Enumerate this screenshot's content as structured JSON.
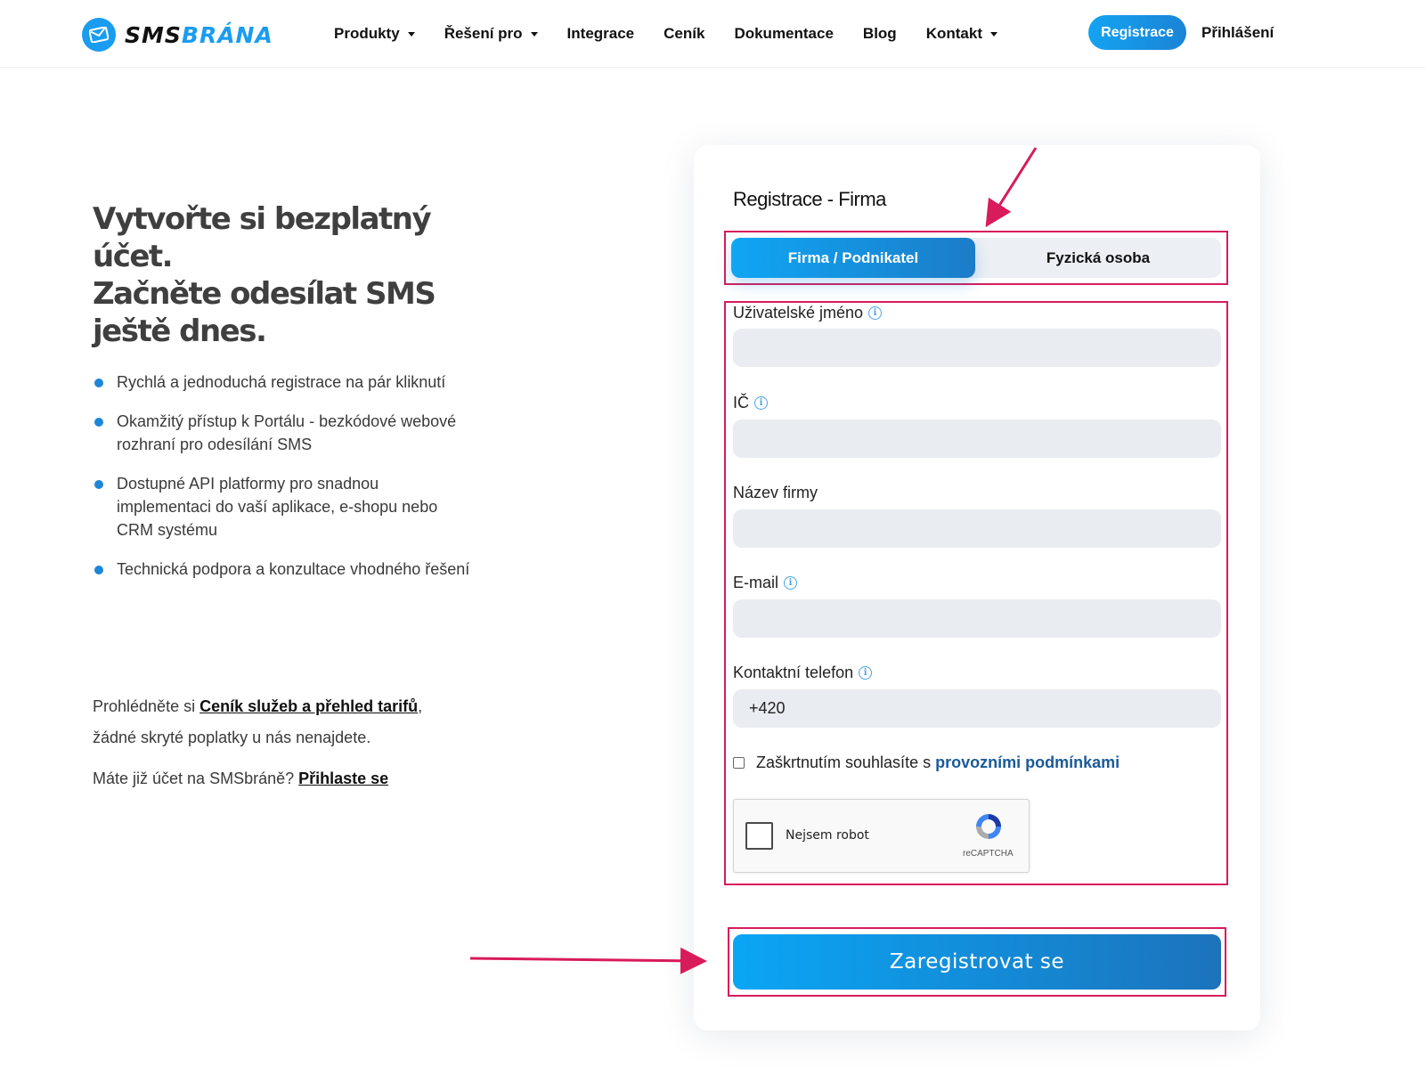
{
  "header": {
    "logo": {
      "part1": "SMS",
      "part2": "BRÁNA"
    },
    "nav": [
      {
        "label": "Produkty",
        "dropdown": true
      },
      {
        "label": "Řešení pro",
        "dropdown": true
      },
      {
        "label": "Integrace",
        "dropdown": false
      },
      {
        "label": "Ceník",
        "dropdown": false
      },
      {
        "label": "Dokumentace",
        "dropdown": false
      },
      {
        "label": "Blog",
        "dropdown": false
      },
      {
        "label": "Kontakt",
        "dropdown": true
      }
    ],
    "register_label": "Registrace",
    "login_label": "Přihlášení"
  },
  "hero": {
    "title_line1": "Vytvořte si bezplatný účet.",
    "title_line2": "Začněte odesílat SMS",
    "title_line3": "ještě dnes.",
    "bullets": [
      "Rychlá a jednoduchá registrace na pár kliknutí",
      "Okamžitý přístup k Portálu - bezkódové webové rozhraní pro odesílání SMS",
      "Dostupné API platformy pro snadnou implementaci do vaší aplikace, e-shopu nebo CRM systému",
      "Technická podpora a konzultace vhodného řešení"
    ],
    "pricing_prefix": "Prohlédněte si",
    "pricing_link": "Ceník služeb a přehled tarifů",
    "pricing_suffix": ",",
    "pricing_line2": "žádné skryté poplatky u nás nenajdete.",
    "login_prefix": "Máte již účet na SMSbráně?",
    "login_link": "Přihlaste se"
  },
  "form": {
    "title": "Registrace - Firma",
    "tab_company": "Firma / Podnikatel",
    "tab_person": "Fyzická osoba",
    "active_tab": "Firma / Podnikatel",
    "fields": {
      "username": {
        "label": "Uživatelské jméno",
        "value": ""
      },
      "ico": {
        "label": "IČ",
        "value": ""
      },
      "company_name": {
        "label": "Název firmy",
        "value": ""
      },
      "email": {
        "label": "E-mail",
        "value": ""
      },
      "phone": {
        "label": "Kontaktní telefon",
        "value": "+420"
      }
    },
    "terms_text": "Zaškrtnutím souhlasíte s",
    "terms_link": "provozními podmínkami",
    "terms_checked": false,
    "recaptcha_label": "Nejsem robot",
    "recaptcha_brand": "reCAPTCHA",
    "submit_label": "Zaregistrovat se"
  },
  "colors": {
    "accent": "#1a9cf0",
    "highlight": "#d81b5a",
    "input_bg": "#e9ecf1"
  }
}
